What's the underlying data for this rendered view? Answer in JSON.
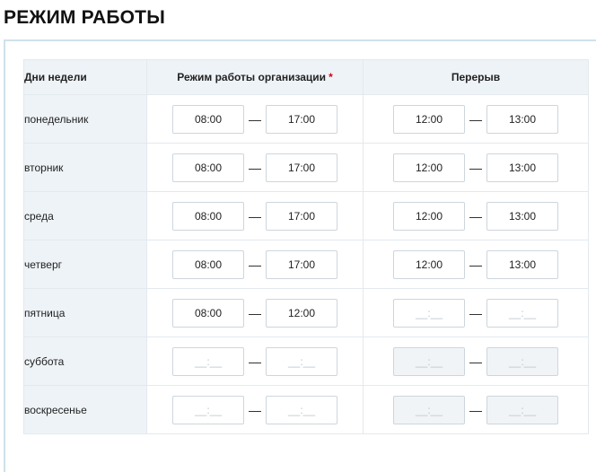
{
  "page": {
    "title": "РЕЖИМ РАБОТЫ"
  },
  "table": {
    "headers": {
      "days": "Дни недели",
      "work": "Режим работы организации",
      "required_mark": "*",
      "break": "Перерыв"
    },
    "dash": "—",
    "empty_placeholder": "__:__",
    "rows": [
      {
        "day": "понедельник",
        "work_from": "08:00",
        "work_to": "17:00",
        "break_from": "12:00",
        "break_to": "13:00"
      },
      {
        "day": "вторник",
        "work_from": "08:00",
        "work_to": "17:00",
        "break_from": "12:00",
        "break_to": "13:00"
      },
      {
        "day": "среда",
        "work_from": "08:00",
        "work_to": "17:00",
        "break_from": "12:00",
        "break_to": "13:00"
      },
      {
        "day": "четверг",
        "work_from": "08:00",
        "work_to": "17:00",
        "break_from": "12:00",
        "break_to": "13:00"
      },
      {
        "day": "пятница",
        "work_from": "08:00",
        "work_to": "12:00",
        "break_from": "",
        "break_to": ""
      },
      {
        "day": "суббота",
        "work_from": "",
        "work_to": "",
        "break_from": "",
        "break_to": "",
        "break_disabled": true
      },
      {
        "day": "воскресенье",
        "work_from": "",
        "work_to": "",
        "break_from": "",
        "break_to": "",
        "break_disabled": true
      }
    ]
  }
}
